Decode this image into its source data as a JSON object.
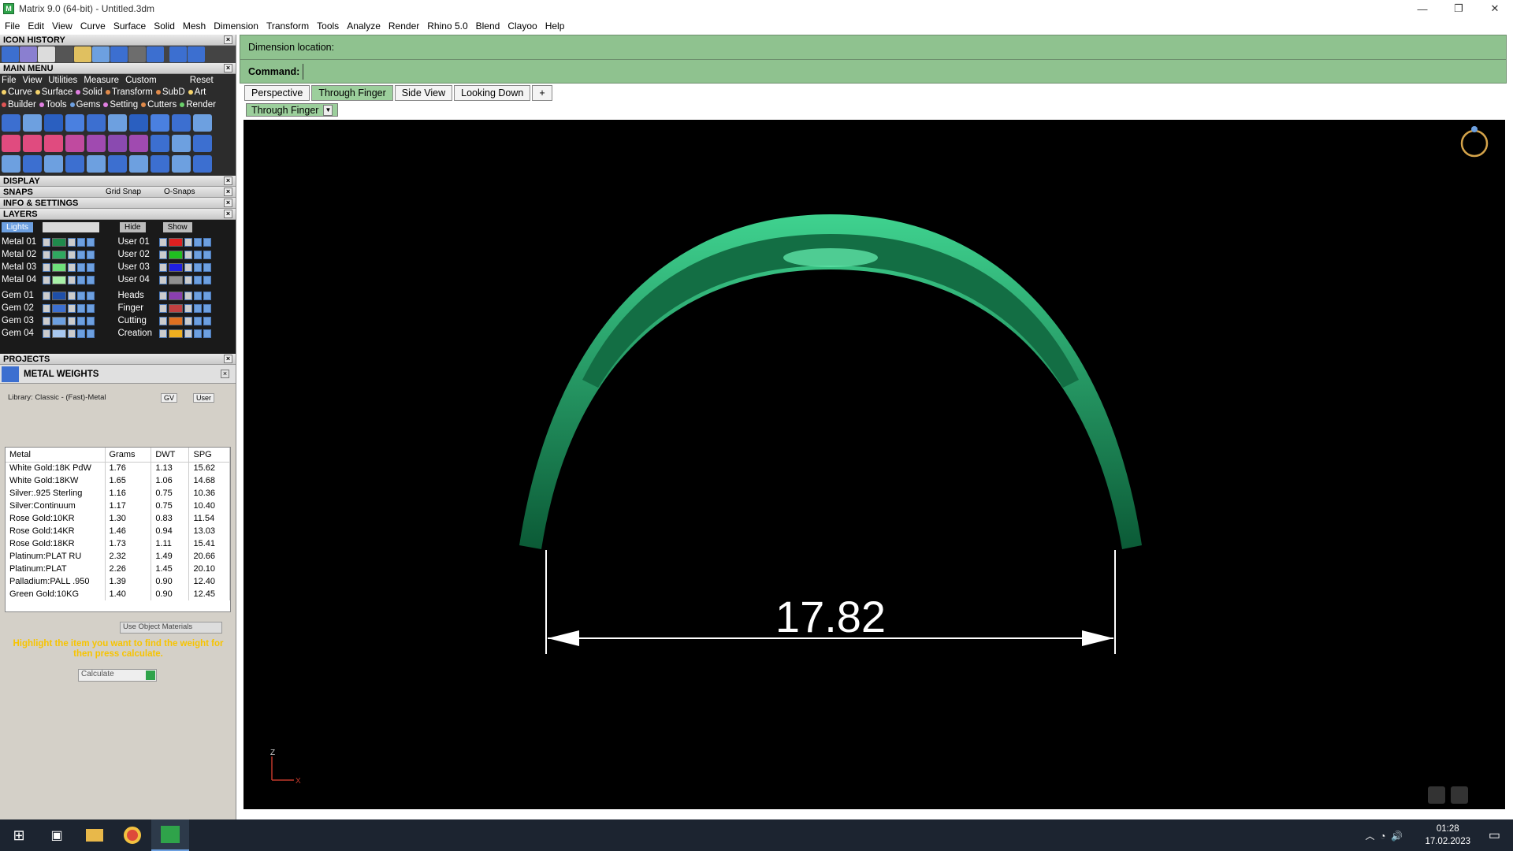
{
  "window": {
    "title": "Matrix 9.0 (64-bit) - Untitled.3dm",
    "controls": [
      "—",
      "❐",
      "✕"
    ]
  },
  "menubar": [
    "File",
    "Edit",
    "View",
    "Curve",
    "Surface",
    "Solid",
    "Mesh",
    "Dimension",
    "Transform",
    "Tools",
    "Analyze",
    "Render",
    "Rhino 5.0",
    "Blend",
    "Clayoo",
    "Help"
  ],
  "left": {
    "icon_history": "ICON HISTORY",
    "main_menu": "MAIN MENU",
    "mm_menu": [
      "File",
      "View",
      "Utilities",
      "Measure",
      "Custom",
      "Reset"
    ],
    "mm_tabs": [
      {
        "label": "Curve",
        "color": "#f5d36b"
      },
      {
        "label": "Surface",
        "color": "#f5d36b"
      },
      {
        "label": "Solid",
        "color": "#e07fe0"
      },
      {
        "label": "Transform",
        "color": "#e08a4a"
      },
      {
        "label": "SubD",
        "color": "#e08a4a"
      },
      {
        "label": "Art",
        "color": "#f5d36b"
      },
      {
        "label": "Builder",
        "color": "#e05555"
      },
      {
        "label": "Tools",
        "color": "#e07fe0"
      },
      {
        "label": "Gems",
        "color": "#6da0e0"
      },
      {
        "label": "Setting",
        "color": "#e07fe0"
      },
      {
        "label": "Cutters",
        "color": "#e08a4a"
      },
      {
        "label": "Render",
        "color": "#6ad06a"
      }
    ],
    "display": "DISPLAY",
    "snaps": "SNAPS",
    "grid_snap": "Grid Snap",
    "o_snaps": "O-Snaps",
    "info_settings": "INFO & SETTINGS",
    "layers_title": "LAYERS",
    "lights": "Lights",
    "hide": "Hide",
    "show": "Show",
    "layers_left": [
      {
        "name": "Metal 01",
        "color": "#1f8a4c"
      },
      {
        "name": "Metal 02",
        "color": "#2fa860"
      },
      {
        "name": "Metal 03",
        "color": "#6ee07a"
      },
      {
        "name": "Metal 04",
        "color": "#a8f0a8"
      },
      {
        "name": "Gem 01",
        "color": "#1e4fa8"
      },
      {
        "name": "Gem 02",
        "color": "#3c6fd0"
      },
      {
        "name": "Gem 03",
        "color": "#6da0e0"
      },
      {
        "name": "Gem 04",
        "color": "#a8c8f0"
      }
    ],
    "layers_right": [
      {
        "name": "User 01",
        "color": "#e02020"
      },
      {
        "name": "User 02",
        "color": "#20c020"
      },
      {
        "name": "User 03",
        "color": "#2020e0"
      },
      {
        "name": "User 04",
        "color": "#909090"
      },
      {
        "name": "Heads",
        "color": "#8a3fb0"
      },
      {
        "name": "Finger",
        "color": "#c04040"
      },
      {
        "name": "Cutting",
        "color": "#e07020"
      },
      {
        "name": "Creation",
        "color": "#f0b020"
      }
    ],
    "projects": "PROJECTS",
    "metal_weights": "METAL WEIGHTS",
    "library": "Library: Classic - (Fast)-Metal",
    "gv": "GV",
    "user": "User",
    "table_headers": [
      "Metal",
      "Grams",
      "DWT",
      "SPG"
    ],
    "table_rows": [
      [
        "White Gold:18K PdW",
        "1.76",
        "1.13",
        "15.62"
      ],
      [
        "White Gold:18KW",
        "1.65",
        "1.06",
        "14.68"
      ],
      [
        "Silver:.925 Sterling",
        "1.16",
        "0.75",
        "10.36"
      ],
      [
        "Silver:Continuum",
        "1.17",
        "0.75",
        "10.40"
      ],
      [
        "Rose Gold:10KR",
        "1.30",
        "0.83",
        "11.54"
      ],
      [
        "Rose Gold:14KR",
        "1.46",
        "0.94",
        "13.03"
      ],
      [
        "Rose Gold:18KR",
        "1.73",
        "1.11",
        "15.41"
      ],
      [
        "Platinum:PLAT RU",
        "2.32",
        "1.49",
        "20.66"
      ],
      [
        "Platinum:PLAT",
        "2.26",
        "1.45",
        "20.10"
      ],
      [
        "Palladium:PALL .950",
        "1.39",
        "0.90",
        "12.40"
      ],
      [
        "Green Gold:10KG",
        "1.40",
        "0.90",
        "12.45"
      ]
    ],
    "use_object_materials": "Use Object Materials",
    "hint": "Highlight the item you want to find the weight for then press calculate.",
    "calculate": "Calculate"
  },
  "command": {
    "prompt": "Dimension location:",
    "label": "Command:"
  },
  "viewport_tabs": [
    "Perspective",
    "Through Finger",
    "Side View",
    "Looking Down",
    "+"
  ],
  "viewport_select": "Through Finger",
  "dimension_value": "17.82",
  "axis": {
    "z": "Z",
    "x": "X"
  },
  "clock": {
    "time": "01:28",
    "date": "17.02.2023"
  }
}
